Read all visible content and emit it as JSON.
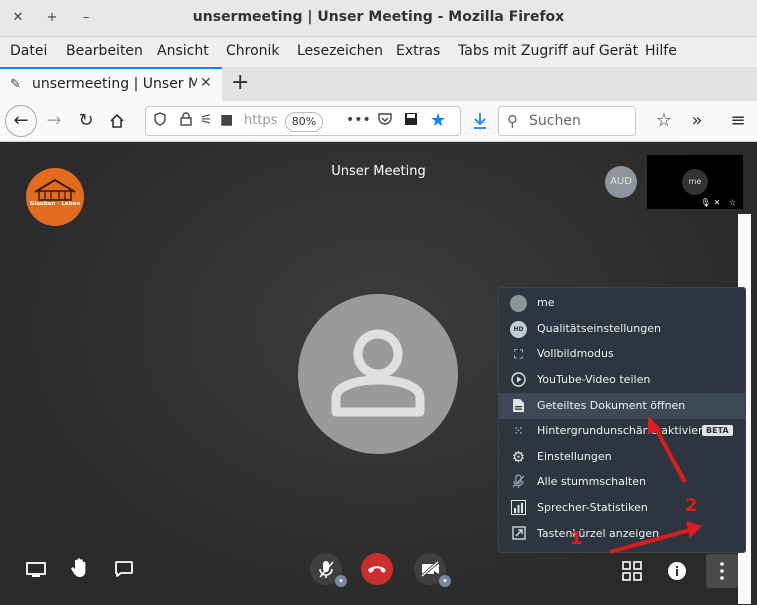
{
  "window": {
    "title": "unsermeeting | Unser Meeting - Mozilla Firefox"
  },
  "menubar": [
    "Datei",
    "Bearbeiten",
    "Ansicht",
    "Chronik",
    "Lesezeichen",
    "Extras",
    "Tabs mit Zugriff auf Gerät",
    "Hilfe"
  ],
  "tab": {
    "label": "unsermeeting | Unser Meeting"
  },
  "urlbar": {
    "text": "https",
    "zoom": "80%"
  },
  "search": {
    "placeholder": "Suchen"
  },
  "meeting": {
    "title": "Unser Meeting",
    "logo_text": "Glauben · Leben",
    "aud_badge": "AUD",
    "thumb_name": "me"
  },
  "menu": {
    "items": [
      {
        "label": "me",
        "icon": "user-avatar-icon"
      },
      {
        "label": "Qualitätseinstellungen",
        "icon": "hd-icon",
        "badge": "HD"
      },
      {
        "label": "Vollbildmodus",
        "icon": "fullscreen-icon"
      },
      {
        "label": "YouTube-Video teilen",
        "icon": "play-icon"
      },
      {
        "label": "Geteiltes Dokument öffnen",
        "icon": "document-icon"
      },
      {
        "label": "Hintergrundunschärfe aktivieren",
        "icon": "blur-icon",
        "tag": "BETA"
      },
      {
        "label": "Einstellungen",
        "icon": "gear-icon"
      },
      {
        "label": "Alle stummschalten",
        "icon": "mute-all-icon"
      },
      {
        "label": "Sprecher-Statistiken",
        "icon": "stats-icon"
      },
      {
        "label": "Tastenkürzel anzeigen",
        "icon": "shortcut-icon"
      }
    ]
  },
  "annotations": {
    "one": "1",
    "two": "2",
    "color": "#e01b1b"
  }
}
